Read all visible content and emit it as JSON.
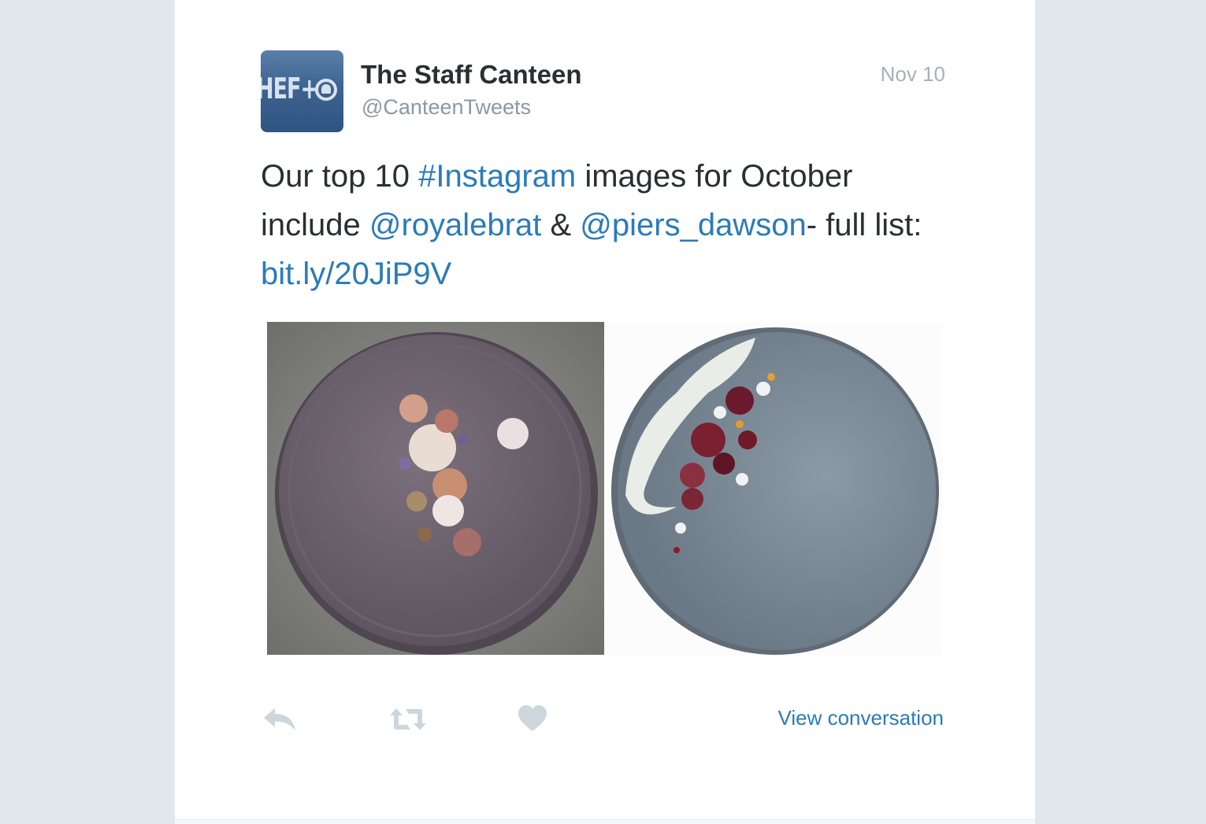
{
  "tweet": {
    "author_name": "The Staff Canteen",
    "author_handle": "@CanteenTweets",
    "avatar_text": "HEF+",
    "date": "Nov 10",
    "text_parts": {
      "p1": "Our top 10 ",
      "hashtag": "#Instagram",
      "p2": " images for October include ",
      "mention1": "@royalebrat",
      "p3": " & ",
      "mention2": "@piers_dawson",
      "p4": "- full list: ",
      "link": "bit.ly/20JiP9V"
    }
  },
  "actions": {
    "reply_icon": "reply-icon",
    "retweet_icon": "retweet-icon",
    "like_icon": "heart-icon",
    "view_conversation": "View conversation"
  },
  "colors": {
    "link": "#2b7bb9",
    "text": "#292f33",
    "muted": "#8899a6",
    "background": "#e1e8ed",
    "action_icon": "#ccd6dd"
  }
}
